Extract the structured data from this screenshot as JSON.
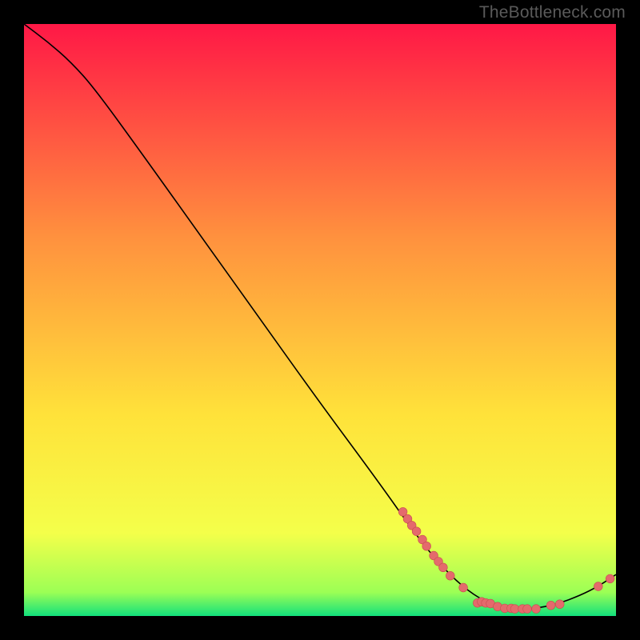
{
  "watermark": "TheBottleneck.com",
  "colors": {
    "background": "#000000",
    "gradient_top": "#ff1846",
    "gradient_mid1": "#ff913e",
    "gradient_mid2": "#ffe23a",
    "gradient_low": "#f4ff4a",
    "gradient_bottom": "#12e07c",
    "curve": "#000000",
    "marker_fill": "#e46a6c",
    "marker_stroke": "#c94e50"
  },
  "chart_data": {
    "type": "line",
    "title": "",
    "xlabel": "",
    "ylabel": "",
    "xlim": [
      0,
      100
    ],
    "ylim": [
      0,
      100
    ],
    "curve": [
      {
        "x": 0,
        "y": 100
      },
      {
        "x": 4,
        "y": 97
      },
      {
        "x": 8,
        "y": 93.5
      },
      {
        "x": 12,
        "y": 89
      },
      {
        "x": 20,
        "y": 78
      },
      {
        "x": 30,
        "y": 64
      },
      {
        "x": 40,
        "y": 50
      },
      {
        "x": 50,
        "y": 36
      },
      {
        "x": 60,
        "y": 22.5
      },
      {
        "x": 66,
        "y": 14
      },
      {
        "x": 70,
        "y": 9
      },
      {
        "x": 74,
        "y": 5
      },
      {
        "x": 78,
        "y": 2.3
      },
      {
        "x": 82,
        "y": 1.2
      },
      {
        "x": 86,
        "y": 1.2
      },
      {
        "x": 90,
        "y": 2
      },
      {
        "x": 94,
        "y": 3.5
      },
      {
        "x": 97,
        "y": 5
      },
      {
        "x": 100,
        "y": 7
      }
    ],
    "markers": [
      {
        "x": 64.0,
        "y": 17.6
      },
      {
        "x": 64.8,
        "y": 16.4
      },
      {
        "x": 65.5,
        "y": 15.3
      },
      {
        "x": 66.3,
        "y": 14.3
      },
      {
        "x": 67.3,
        "y": 12.9
      },
      {
        "x": 68.0,
        "y": 11.8
      },
      {
        "x": 69.2,
        "y": 10.2
      },
      {
        "x": 70.0,
        "y": 9.2
      },
      {
        "x": 70.8,
        "y": 8.2
      },
      {
        "x": 72.0,
        "y": 6.8
      },
      {
        "x": 74.2,
        "y": 4.8
      },
      {
        "x": 76.6,
        "y": 2.2
      },
      {
        "x": 77.3,
        "y": 2.4
      },
      {
        "x": 78.0,
        "y": 2.2
      },
      {
        "x": 78.8,
        "y": 2.1
      },
      {
        "x": 80.0,
        "y": 1.6
      },
      {
        "x": 81.2,
        "y": 1.3
      },
      {
        "x": 82.3,
        "y": 1.3
      },
      {
        "x": 82.9,
        "y": 1.2
      },
      {
        "x": 84.2,
        "y": 1.2
      },
      {
        "x": 85.0,
        "y": 1.2
      },
      {
        "x": 86.5,
        "y": 1.2
      },
      {
        "x": 89.0,
        "y": 1.8
      },
      {
        "x": 90.5,
        "y": 2.0
      },
      {
        "x": 97.0,
        "y": 5.0
      },
      {
        "x": 99.0,
        "y": 6.3
      }
    ]
  }
}
